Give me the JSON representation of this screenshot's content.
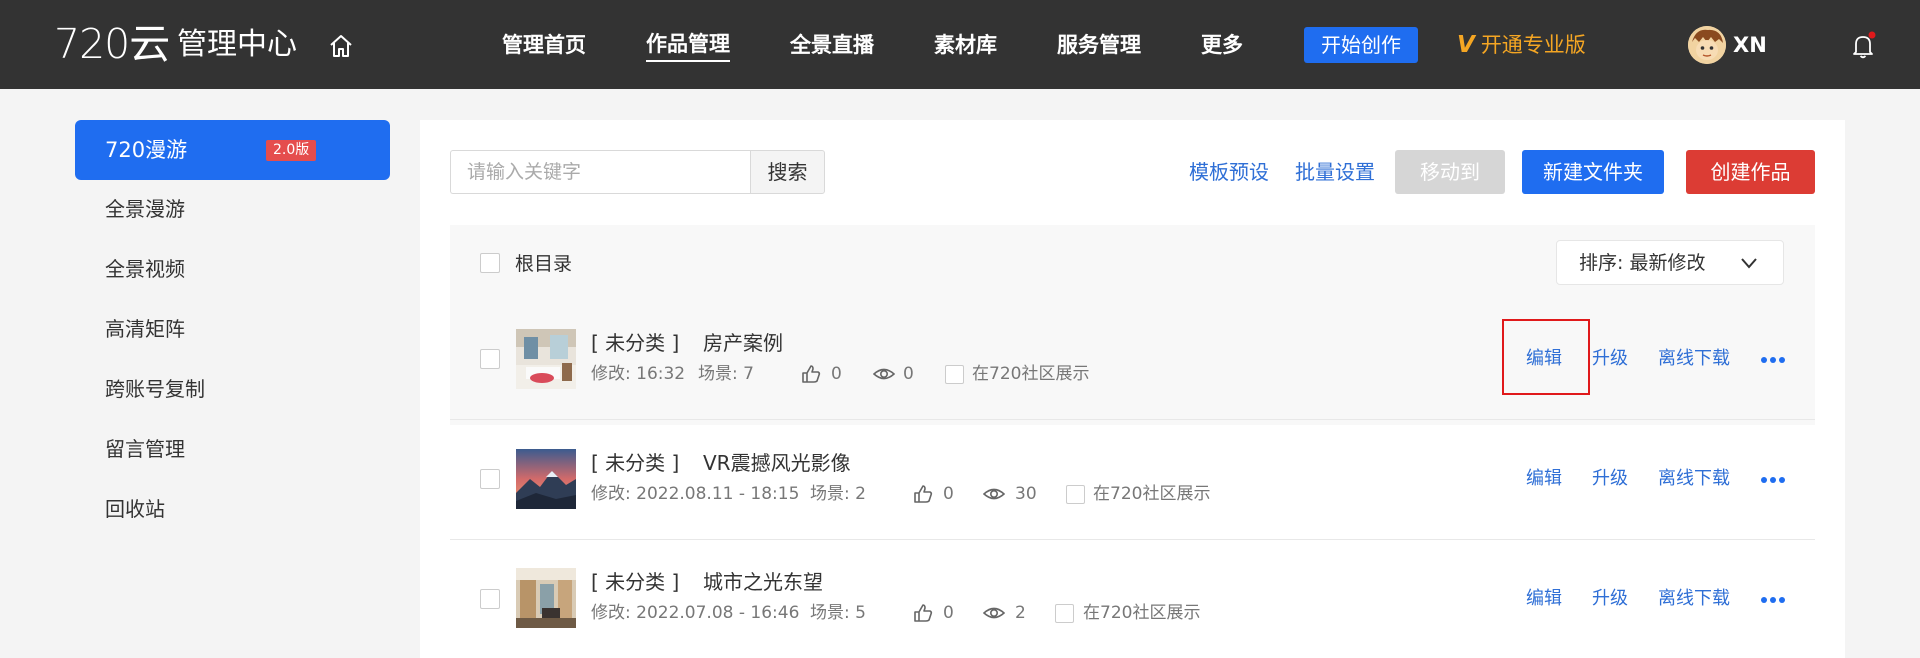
{
  "header": {
    "logo": "720云",
    "title": "管理中心",
    "nav": [
      "管理首页",
      "作品管理",
      "全景直播",
      "素材库",
      "服务管理",
      "更多"
    ],
    "create_label": "开始创作",
    "pro_v": "V",
    "pro_label": "开通专业版",
    "username": "XN"
  },
  "sidebar": {
    "active_label": "720漫游",
    "active_badge": "2.0版",
    "items": [
      "全景漫游",
      "全景视频",
      "高清矩阵",
      "跨账号复制",
      "留言管理",
      "回收站"
    ]
  },
  "toolbar": {
    "search_placeholder": "请输入关键字",
    "search_label": "搜索",
    "template_preview": "模板预设",
    "batch_settings": "批量设置",
    "move_to": "移动到",
    "new_folder": "新建文件夹",
    "create_work": "创建作品"
  },
  "list": {
    "root_label": "根目录",
    "sort_label": "排序:  最新修改",
    "actions": {
      "edit": "编辑",
      "upgrade": "升级",
      "offline": "离线下载"
    },
    "community_label": "在720社区展示",
    "rows": [
      {
        "category": "[ 未分类 ]",
        "name": "房产案例",
        "modified": "修改: 16:32",
        "scenes": "场景: 7",
        "likes": "0",
        "views": "0"
      },
      {
        "category": "[ 未分类 ]",
        "name": "VR震撼风光影像",
        "modified": "修改: 2022.08.11 - 18:15",
        "scenes": "场景: 2",
        "likes": "0",
        "views": "30"
      },
      {
        "category": "[ 未分类 ]",
        "name": "城市之光东望",
        "modified": "修改: 2022.07.08 - 16:46",
        "scenes": "场景: 5",
        "likes": "0",
        "views": "2"
      }
    ]
  },
  "colors": {
    "topbar": "#333333",
    "accent": "#1f6df0",
    "danger": "#dc3c34",
    "link": "#2f6fd6",
    "pro": "#f5a623",
    "highlight": "#e0191b"
  }
}
